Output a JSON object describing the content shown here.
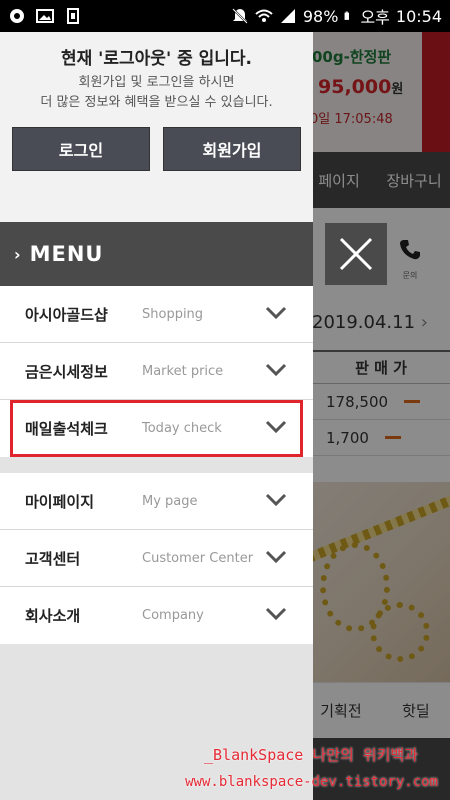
{
  "status_bar": {
    "battery": "98%",
    "ampm": "오후",
    "time": "10:54"
  },
  "background": {
    "banner_line1": "00g-한정판",
    "banner_price": "95,000",
    "banner_price_unit": "원",
    "banner_line3": "0일 17:05:48",
    "nav_items": [
      "페이지",
      "장바구니"
    ],
    "phone_label": "문의",
    "date": "2019.04.11",
    "table_header": "판 매 가",
    "rows": [
      "178,500",
      "1,700"
    ],
    "bottom_tabs": [
      "기획전",
      "핫딜"
    ]
  },
  "drawer": {
    "login_title": "현재 '로그아웃' 중 입니다.",
    "login_sub1": "회원가입 및 로그인을 하시면",
    "login_sub2": "더 많은 정보와 혜택을 받으실 수 있습니다.",
    "login_button": "로그인",
    "join_button": "회원가입",
    "menu_title": "MENU",
    "menu_group1": [
      {
        "label": "아시아골드샵",
        "sub": "Shopping"
      },
      {
        "label": "금은시세정보",
        "sub": "Market price"
      },
      {
        "label": "매일출석체크",
        "sub": "Today check"
      }
    ],
    "menu_group2": [
      {
        "label": "마이페이지",
        "sub": "My page"
      },
      {
        "label": "고객센터",
        "sub": "Customer Center"
      },
      {
        "label": "회사소개",
        "sub": "Company"
      }
    ]
  },
  "watermark": {
    "line1": "_BlankSpace 나만의 위키백과",
    "line2": "www.blankspace-dev.tistory.com"
  },
  "colors": {
    "highlight": "#e0242b",
    "menu_header_bg": "#4a4a4a",
    "button_bg": "#494c55"
  }
}
